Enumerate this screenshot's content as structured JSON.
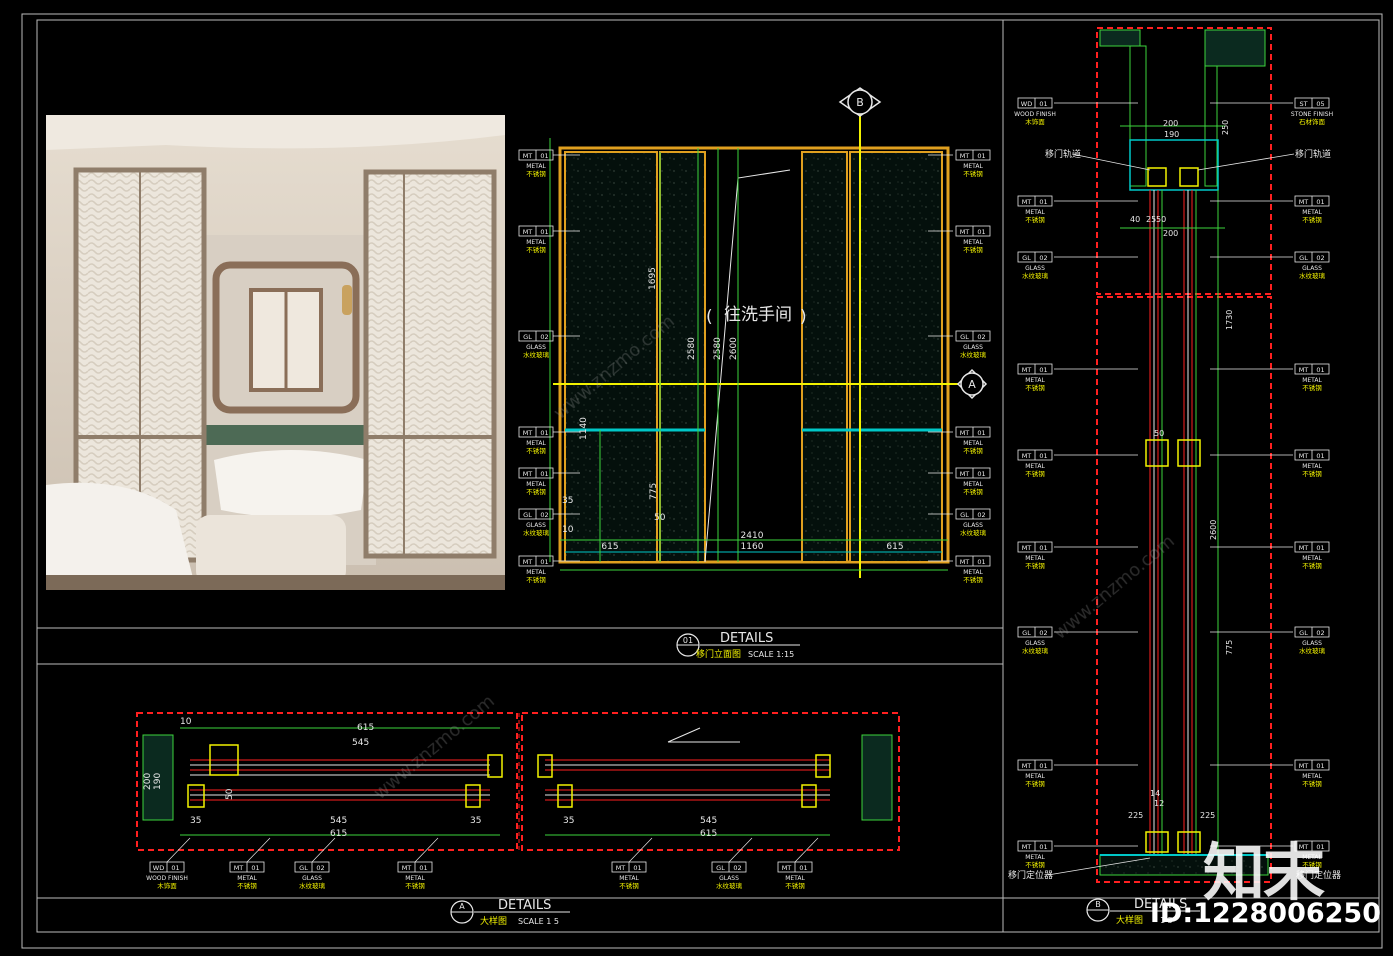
{
  "watermark": {
    "logo": "知末",
    "id": "ID:1228006250",
    "url": "www.znzmo.com"
  },
  "elevation": {
    "title": "DETAILS",
    "subtitle": "移门立面图",
    "scale": "SCALE  1:15",
    "number": "01",
    "note": "往洗手间",
    "marker_b": "B",
    "marker_a": "A",
    "dims": {
      "d2410": "2410",
      "d1160": "1160",
      "d615a": "615",
      "d615b": "615",
      "d1695": "1695",
      "d2580a": "2580",
      "d2580b": "2580",
      "d2600": "2600",
      "d1140": "1140",
      "d775": "775",
      "d35": "35",
      "d10": "10",
      "d50": "50"
    },
    "tags_left": [
      {
        "code": "MT",
        "num": "01",
        "mat": "METAL",
        "cn": "不锈钢"
      },
      {
        "code": "MT",
        "num": "01",
        "mat": "METAL",
        "cn": "不锈钢"
      },
      {
        "code": "GL",
        "num": "02",
        "mat": "GLASS",
        "cn": "水纹玻璃"
      },
      {
        "code": "MT",
        "num": "01",
        "mat": "METAL",
        "cn": "不锈钢"
      },
      {
        "code": "MT",
        "num": "01",
        "mat": "METAL",
        "cn": "不锈钢"
      },
      {
        "code": "GL",
        "num": "02",
        "mat": "GLASS",
        "cn": "水纹玻璃"
      },
      {
        "code": "MT",
        "num": "01",
        "mat": "METAL",
        "cn": "不锈钢"
      }
    ],
    "tags_right": [
      {
        "code": "MT",
        "num": "01",
        "mat": "METAL",
        "cn": "不锈钢"
      },
      {
        "code": "MT",
        "num": "01",
        "mat": "METAL",
        "cn": "不锈钢"
      },
      {
        "code": "GL",
        "num": "02",
        "mat": "GLASS",
        "cn": "水纹玻璃"
      },
      {
        "code": "MT",
        "num": "01",
        "mat": "METAL",
        "cn": "不锈钢"
      },
      {
        "code": "MT",
        "num": "01",
        "mat": "METAL",
        "cn": "不锈钢"
      },
      {
        "code": "GL",
        "num": "02",
        "mat": "GLASS",
        "cn": "水纹玻璃"
      },
      {
        "code": "MT",
        "num": "01",
        "mat": "METAL",
        "cn": "不锈钢"
      }
    ]
  },
  "plan": {
    "title": "DETAILS",
    "subtitle": "大样图",
    "scale": "SCALE  1 5",
    "letter": "A",
    "dims": {
      "d615": "615",
      "d545": "545",
      "d35": "35",
      "d10": "10",
      "d200": "200",
      "d190": "190",
      "d50": "50"
    },
    "tags": [
      {
        "code": "WD",
        "num": "01",
        "mat": "WOOD FINISH",
        "cn": "木饰面"
      },
      {
        "code": "MT",
        "num": "01",
        "mat": "METAL",
        "cn": "不锈钢"
      },
      {
        "code": "GL",
        "num": "02",
        "mat": "GLASS",
        "cn": "水纹玻璃"
      },
      {
        "code": "MT",
        "num": "01",
        "mat": "METAL",
        "cn": "不锈钢"
      },
      {
        "code": "MT",
        "num": "01",
        "mat": "METAL",
        "cn": "不锈钢"
      },
      {
        "code": "GL",
        "num": "02",
        "mat": "GLASS",
        "cn": "水纹玻璃"
      },
      {
        "code": "MT",
        "num": "01",
        "mat": "METAL",
        "cn": "不锈钢"
      }
    ]
  },
  "section": {
    "title": "DETAILS",
    "subtitle": "大样图",
    "scale": "1 5",
    "letter": "B",
    "track_left": "移门轨道",
    "track_right": "移门轨道",
    "locator_left": "移门定位器",
    "locator_right": "移门定位器",
    "dims": {
      "d200": "200",
      "d190": "190",
      "d250": "250",
      "d1730": "1730",
      "d2600": "2600",
      "d775": "775",
      "d225": "225",
      "d50": "50",
      "d40": "40",
      "d25": "25",
      "d14": "14",
      "d12": "12"
    },
    "tags_left": [
      {
        "code": "WD",
        "num": "01",
        "mat": "WOOD FINISH",
        "cn": "木饰面"
      },
      {
        "code": "MT",
        "num": "01",
        "mat": "METAL",
        "cn": "不锈钢"
      },
      {
        "code": "GL",
        "num": "02",
        "mat": "GLASS",
        "cn": "水纹玻璃"
      },
      {
        "code": "MT",
        "num": "01",
        "mat": "METAL",
        "cn": "不锈钢"
      },
      {
        "code": "MT",
        "num": "01",
        "mat": "METAL",
        "cn": "不锈钢"
      },
      {
        "code": "MT",
        "num": "01",
        "mat": "METAL",
        "cn": "不锈钢"
      },
      {
        "code": "GL",
        "num": "02",
        "mat": "GLASS",
        "cn": "水纹玻璃"
      },
      {
        "code": "MT",
        "num": "01",
        "mat": "METAL",
        "cn": "不锈钢"
      },
      {
        "code": "MT",
        "num": "01",
        "mat": "METAL",
        "cn": "不锈钢"
      }
    ],
    "tags_right": [
      {
        "code": "ST",
        "num": "05",
        "mat": "STONE FINISH",
        "cn": "石材饰面"
      },
      {
        "code": "MT",
        "num": "01",
        "mat": "METAL",
        "cn": "不锈钢"
      },
      {
        "code": "GL",
        "num": "02",
        "mat": "GLASS",
        "cn": "水纹玻璃"
      },
      {
        "code": "MT",
        "num": "01",
        "mat": "METAL",
        "cn": "不锈钢"
      },
      {
        "code": "MT",
        "num": "01",
        "mat": "METAL",
        "cn": "不锈钢"
      },
      {
        "code": "MT",
        "num": "01",
        "mat": "METAL",
        "cn": "不锈钢"
      },
      {
        "code": "GL",
        "num": "02",
        "mat": "GLASS",
        "cn": "水纹玻璃"
      },
      {
        "code": "MT",
        "num": "01",
        "mat": "METAL",
        "cn": "不锈钢"
      },
      {
        "code": "MT",
        "num": "01",
        "mat": "METAL",
        "cn": "不锈钢"
      }
    ]
  },
  "colors": {
    "frame": "#e0a01f",
    "glass": "#1a3a30",
    "yellow": "#f2f200",
    "cyan": "#00c8c8",
    "red": "#ff2020",
    "green": "#3cd43c",
    "white": "#e8e8e8",
    "magenta": "#ff40ff"
  }
}
